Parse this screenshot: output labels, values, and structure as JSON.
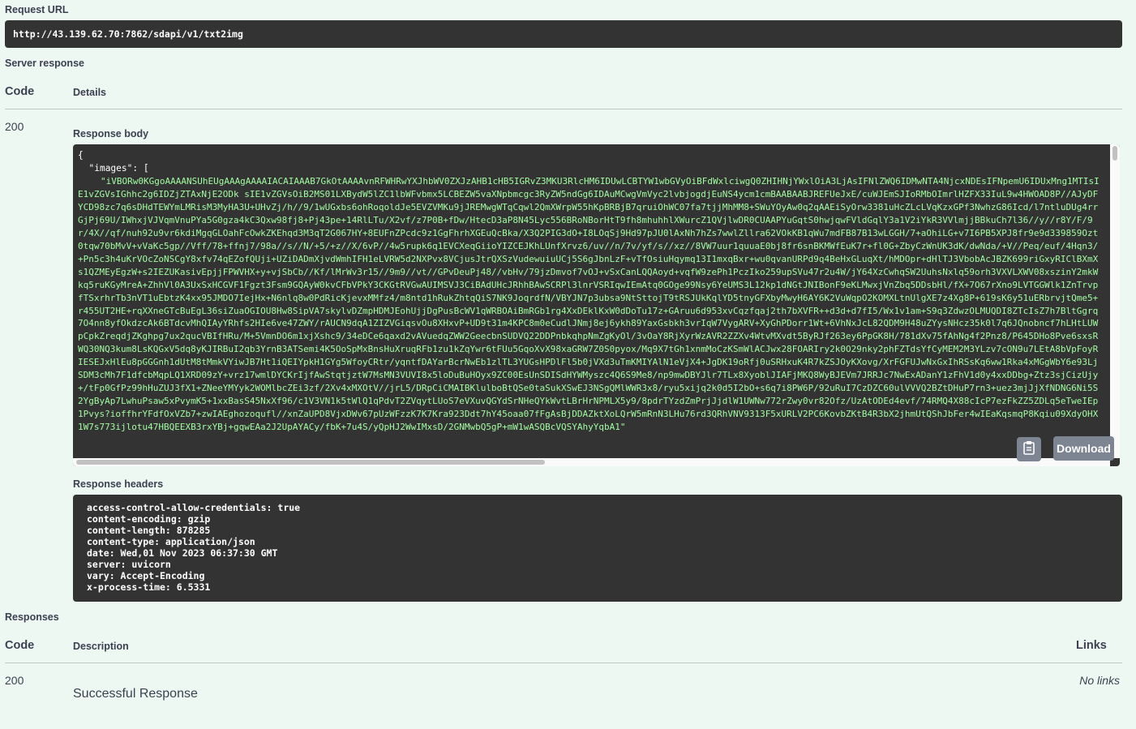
{
  "request_url": {
    "label": "Request URL",
    "value": "http://43.139.62.70:7862/sdapi/v1/txt2img"
  },
  "server_response": {
    "label": "Server response",
    "columns": {
      "code": "Code",
      "details": "Details"
    },
    "code": "200",
    "response_body_label": "Response body",
    "response_body_open": "{",
    "response_body_images_key": "\"images\": [",
    "response_body_data": "\"iVBORw0KGgoAAAANSUhEUgAAAgAAAAIACAIAAAB7GkOtAAAAvnRFWHRwYXJhbWV0ZXJzAHB1cHB5IGRvZ3MKU3RlcHM6IDUwLCBTYW1wbGVyOiBFdWxlciwgQ0ZHIHNjYWxlOiA3LjAsIFNlZWQ6IDMwNTA4NjcxNDEsIFNpemU6IDUxMng1MTIsIE1vZGVsIGhhc2g6IDZjZTAxNjE2ODk sIE1vZGVsOiB2MS01LXBydW5lZC1lbWFvbmx5LCBEZW5vaXNpbmcgc3RyZW5ndGg6IDAuMCwgVmVyc2lvbjogdjEuNS4ycm1cmBAABAABJREFUeJxE/cuWJEmSJIoRMbOImrlHZFX33IuL9w4HWOAD8P//AJyDFYCD98zc7q6sDHdTEWYmLMRisM3MyHA3U+UHvZj/h//9/1wUGxbs6ohRoqoldJe5EVZVMKu9jJREMwgWTqCqwl2QmXWrpW55hKpBRBjB7qruiOhWC07fa7tjjMhMM8+SWuYOyAw0q2qAAEiSyOrw3381uHcZLcLVqKzxGPf3NwhzG86Icd/l7ntluDUg4rrGjPj69U/IWhxjVJVqmVnuPYa5G0gza4kC3Qxw98fj8+Pj43pe+14RlLTu/X2vf/z7P0B+fDw/HtecD3aP8N45Lyc556BRoNBorHtT9fh8mhuhhlXWurcZ1QVjlwDR0CUAAPYuGqtS0hwjqwFVldGqlY3a1V2iYkR3VVlmjjBBkuCh7l36//y//r8Y/F/9r/4X//qf/nuh92u9vr6kdiMgqGLOahFcOwkZKEhqd3M3qT2G067HY+8EUFnZPcdc9z1GgFhrhXGEuQcBka/X3Q2PIG3dO+I8LOqSj9Hd97pJU0lAxNh7hZs7wwlZllra62VOkKB1qWu7mdFB87B13wLGGH/7+aOhiLG+v7I6PB5XPJ8fr9e9d339859Ozt0tqw70bMvV+vVaKc5gp//Vff/78+ffnj7/98a//s//N/+5/+z//X/6vP//4w5rupk6q1EVCXeqGiioYIZCEJKhLUnfXrvz6/uv//n/7v/yf/s//xz//8VW7uur1quuaE0bj8fr6snBKMWfEuK7r+fl0G+ZbyCzWnUK3dK/dwNda/+V//Peq/euf/4Hqn3/+Pn5c3h4uKrVOcZoNSCgY8xfv74qEZofQUji+UZiDADmXjvdWmhIFH1eLVRW5d2NXPvx8VCjusJtrQXSzVudewuiuUCj5S6gJbnLzF+vTfOsiuHqymq13I1mxqBxr+wu0qvanURPd9q4BeHxGLuqXt/hMDOpr+dHlTJ3VbobAcJBZK699riGxyRIClBXmXs1QZMEyEgzW+s2IEZUKasivEpjjFPWVHX+y+vjSbCb//Kf/lMrWv3r15//9m9//vt//GPvDeuPj48//vbHv/79jzDmvof7vOJ+vSxCanLQQAoyd+vqfW9zePh1PczIko259upSVu47r2u4W/jY64XzCwhqSW2UuhsNxlq59orh3VXVLXWV08xszinY2mkWkq5ruKGyMreA+ZhhVl0A3UxSxHCGVF1Fgzt3Fsm9GQAyW0kvCFbVPkY3CKGtRVGwAUIMSVJ3CiBAdUHcJRhhBAwSCRPl3lnrVSRIqwIEmAtq0GOge99Nsy6YeUMS3L12kp1dNGtJNIBonF9eKLMwxjVnZbq5DDsbHl/fX+7O67rXno9LVTGGWlk1ZnTrvpfTSxrhrTb3nVT1uEbtzK4xx95JMDO7IejHx+N6nlq8w0PdRicKjevxMMfz4/m8ntd1hRukZhtqQiS7NK9JoqrdfN/VBYJN7p3ubsa9NtSttojT9tRSJUkKqlYD5tnyGFXbyMwyH6AY6K2VuWqpO2KOMXLtnUlgXE7z4Xg8P+619sK6y51uERbrvjtQme5+r455UT2HE+rqXXneGTcBuEgL36siZuaOGIOU8Hw8SipVA7skylvDZmpHDMJEohUjjDgPusBcWV1qWRBOAiBmRGb1rg4XxDEklKxW0dDoTu17z+GAruu6d953xvCqzfqaj2th7bXVFR++d3d+d7fI5/Wx1v1am+S9q3ZdwzOLMUQDI8ZTcIsZ7h7BltGgrq7O4nn8yfOkdzcAk6BTdcvMhQIAyYRhfs2HIe6ve47ZWY/rAUCN9dqA1ZIZVGiqsvOu8XHxvP+UD9t31m4KPC8m0eCudlJNmj8ej6ykh89YaxGsbkh3vrIqW7VygARV+XyGhPDorr1Wt+6VhNxJcL82QDM9H48uZYysNHcz35k0l7q6JQnobncf7hLHtLUWpCpkZreqdjZKghpg7ux2qucVBIfHRu/M+5VmnDO6m1xjXshc9/34eDCe6qaxd2vAVuedqZWW2GeecbnSUDVQ22DDPnbkqhpNmZgKyOl/3vOaY8RjXyrWzAVR2ZZXv4WtvMXvdt5ByRJf263ey6PpGK8H/781dXv75fAhNg4f2Pnz8/P645DHo8Pve6sxsRWQ30NQ3kum8LsKQGxV5dq8yKJIRBuI2qb3YrnB3ATSemi4K5OoSpMxBnsHuXruqRFb1zu1kZqYwr6tFUu5GqoXvX98xaGRW7Z0S0pyox/Mq9X7tGh1xnmMoCzKSmWlACJwx28FOARIry2k0O29nky2phFZTdsYfCyMEM2M3YLzv7cON9u7LEtA8bVpFoyRIESEJxHlEu8pGGGnh1dUtM8tMmkVYiwJB7Ht1iQEIYpkH1GYg5WfoyCRtr/yqntfDAYarBcrNwEb1zlTL3YUGsHPDlFl5b0jVXd3uTmKMIYAlN1eVjX4+JgDK19oRfj0uSRHxuK4R7kZSJOyKXovg/XrFGFUJwNxGxIhRSsKq6ww1Rka4xMGgWbY6e93LjSDM3cMh7F1dfcbMqpLQ1XRD09zY+vrz17wmlDYCKrIjfAwStqtjztW7MsMN3VUVI8x5loDuBuHOyx9ZC00EsUnSDISdHYWMyszc4Q6S9Me8/np9mwDBYJlr7TLx8XyoblJIAFjMKQ8WyBJEVm7JRRJc7NwExADanY1zFhV1d0y4xxDDbg+Ztz3sjCizUjy+/tFp0GfPz99hHuZUJ3fX1+ZNeeYMYyk2WOMlbcZEi3zf/2Xv4xMXOtV//jrL5/DRpCiCMAIBKlulboBtQSe0taSukXSwEJ3NSgQMlWWR3x8/ryu5xijq2k0d5I2bO+s6q7i8PW6P/92uRuI7CzDZC60ulVVVQ2BZtDHuP7rn3+uez3mjJjXfNDNG6Ni5S2YgByAp7LwhuPsaw5xPvymK5+1xxBasS45NxXf96/c1V3VN1k5tWlQ1qPdvT2ZVqytLUoS7eVXuvQGYdSrNHeQYkWvtLBrHrNPMLX5y9/8pdrTYzdZmPrjJjdlW1UWNw772rZwy0vr82Ofz/UzAtODEd4evf/74RMQ4X88cIcP7ezFkZZ5ZDLq5eTweIEp1Pvys?ioffhrYFdfOxVZb7+zwIAEghozoqufl//xnZaUPD8VjxDWv67pUzWFzzK7K7Kra923Ddt7hY45oaa07fFgAsBjDDAZktXoLQrW5mRnN3LHu76rd3QRhVNV9313F5xURLV2PC6KovbZKtB4R3bX2jhmUtQShJbFer4wIEaKqsmqP8Kqiu09XdyOHX1W7s773ijlotu47HBQEEXB3rxYBj+gqwEAa2J2UpAYACy/fbK+7u4S/yQpHJ2WwIMxsD/2GNMwbQ5gP+mW1wASQBcVQSYAhyYqbA1\""
  },
  "download_label": "Download",
  "response_headers": {
    "label": "Response headers",
    "lines": [
      "access-control-allow-credentials: true",
      "content-encoding: gzip",
      "content-length: 878285",
      "content-type: application/json",
      "date: Wed,01 Nov 2023 06:37:30 GMT",
      "server: uvicorn",
      "vary: Accept-Encoding",
      "x-process-time: 6.5331"
    ]
  },
  "responses": {
    "label": "Responses",
    "columns": {
      "code": "Code",
      "description": "Description",
      "links": "Links"
    },
    "code": "200",
    "description": "Successful Response",
    "links": "No links"
  },
  "colors": {
    "background": "#edf8f3",
    "code_block": "#333333",
    "base64_text": "#a2fca2",
    "button": "#7d8492"
  },
  "icons": {
    "copy": "clipboard-icon"
  }
}
